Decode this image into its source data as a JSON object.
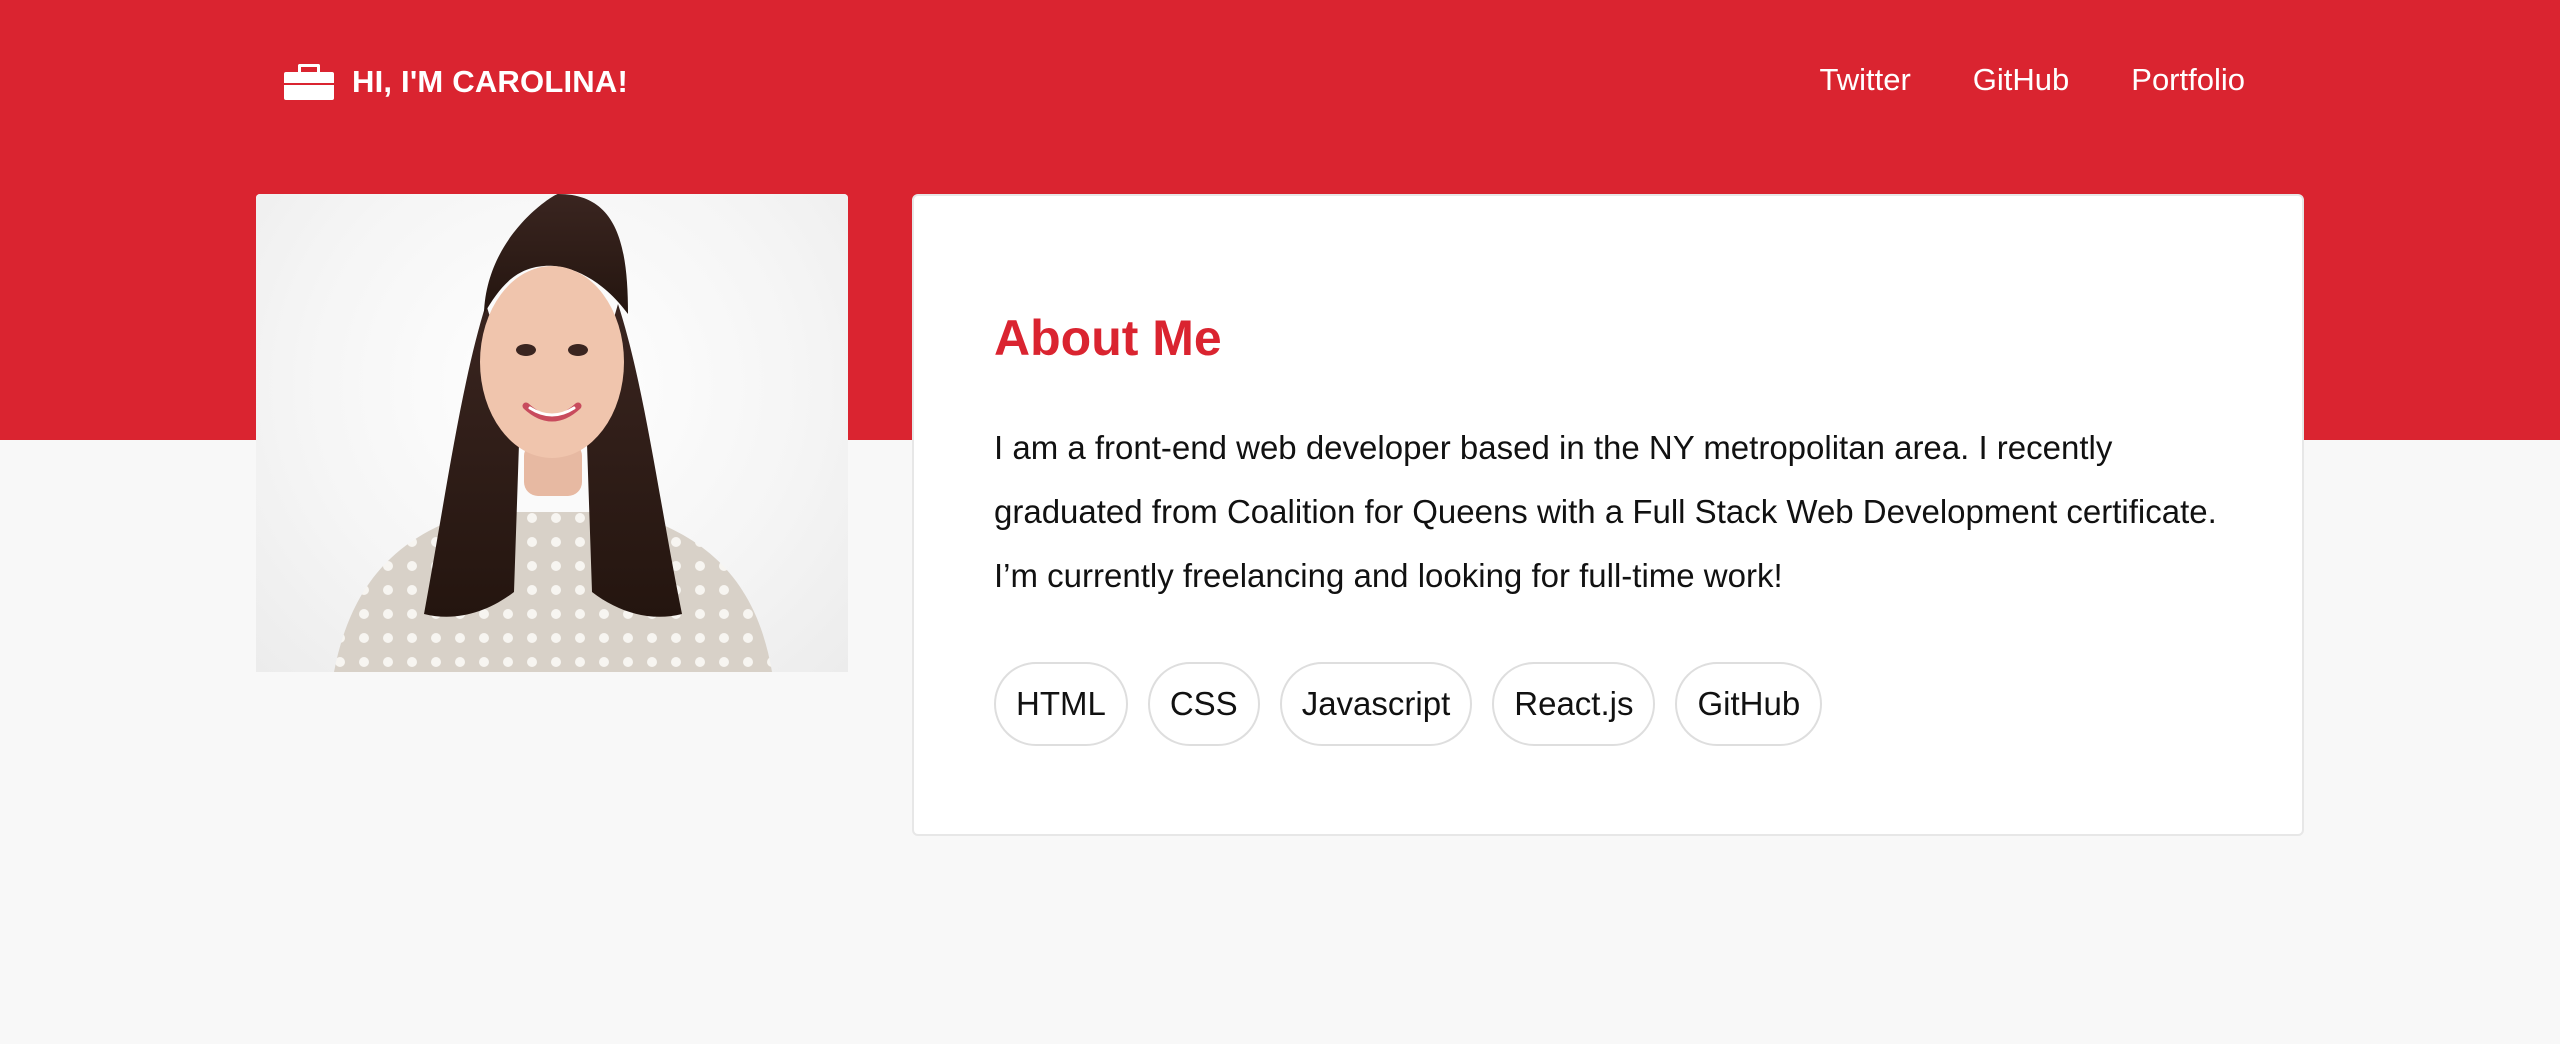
{
  "header": {
    "brand_text": "HI, I'M CAROLINA!",
    "brand_icon": "briefcase-icon",
    "nav": [
      {
        "label": "Twitter"
      },
      {
        "label": "GitHub"
      },
      {
        "label": "Portfolio"
      }
    ]
  },
  "profile": {
    "photo_alt": "Photo of Carolina"
  },
  "about": {
    "title": "About Me",
    "text": "I am a front-end web developer based in the NY metropolitan area. I recently graduated from Coalition for Queens with a Full Stack Web Development certificate. I’m currently freelancing and looking for full-time work!",
    "skills": [
      "HTML",
      "CSS",
      "Javascript",
      "React.js",
      "GitHub"
    ]
  },
  "colors": {
    "brand_red": "#da2430",
    "page_background": "#f8f8f8",
    "card_background": "#ffffff"
  }
}
